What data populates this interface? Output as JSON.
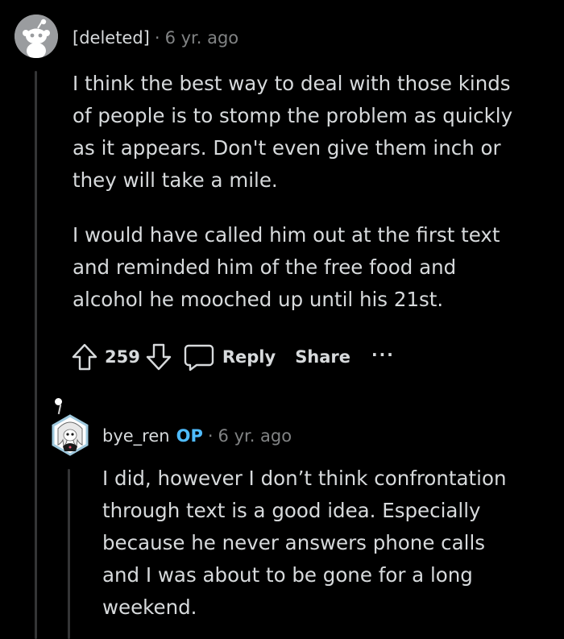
{
  "comment1": {
    "author": "[deleted]",
    "separator": "·",
    "time": "6 yr. ago",
    "paragraphs": [
      [
        "I think the best way to deal with those kinds",
        "of people is to stomp the problem as quickly",
        "as it appears. Don't even give them inch or",
        "they will take a mile."
      ],
      [
        "I would have called him out at the first text",
        "and reminded him of the free food and",
        "alcohol he mooched up until his 21st."
      ]
    ],
    "actions": {
      "upvote_icon": "upvote-arrow-icon",
      "score": "259",
      "downvote_icon": "downvote-arrow-icon",
      "reply_icon": "speech-bubble-icon",
      "reply_label": "Reply",
      "share_label": "Share",
      "more_icon": "ellipsis-icon",
      "more_label": "···"
    }
  },
  "comment2": {
    "author": "bye_ren",
    "op_badge": "OP",
    "separator": "·",
    "time": "6 yr. ago",
    "lines": [
      "I did, however I don’t think confrontation",
      "through text is a good idea. Especially",
      "because he never answers phone calls",
      "and I was about to be gone for a long",
      "weekend."
    ]
  },
  "colors": {
    "background": "#000000",
    "text": "#d7dadc",
    "muted": "#818384",
    "op_blue": "#4fbcff",
    "thread_line": "#343536"
  }
}
